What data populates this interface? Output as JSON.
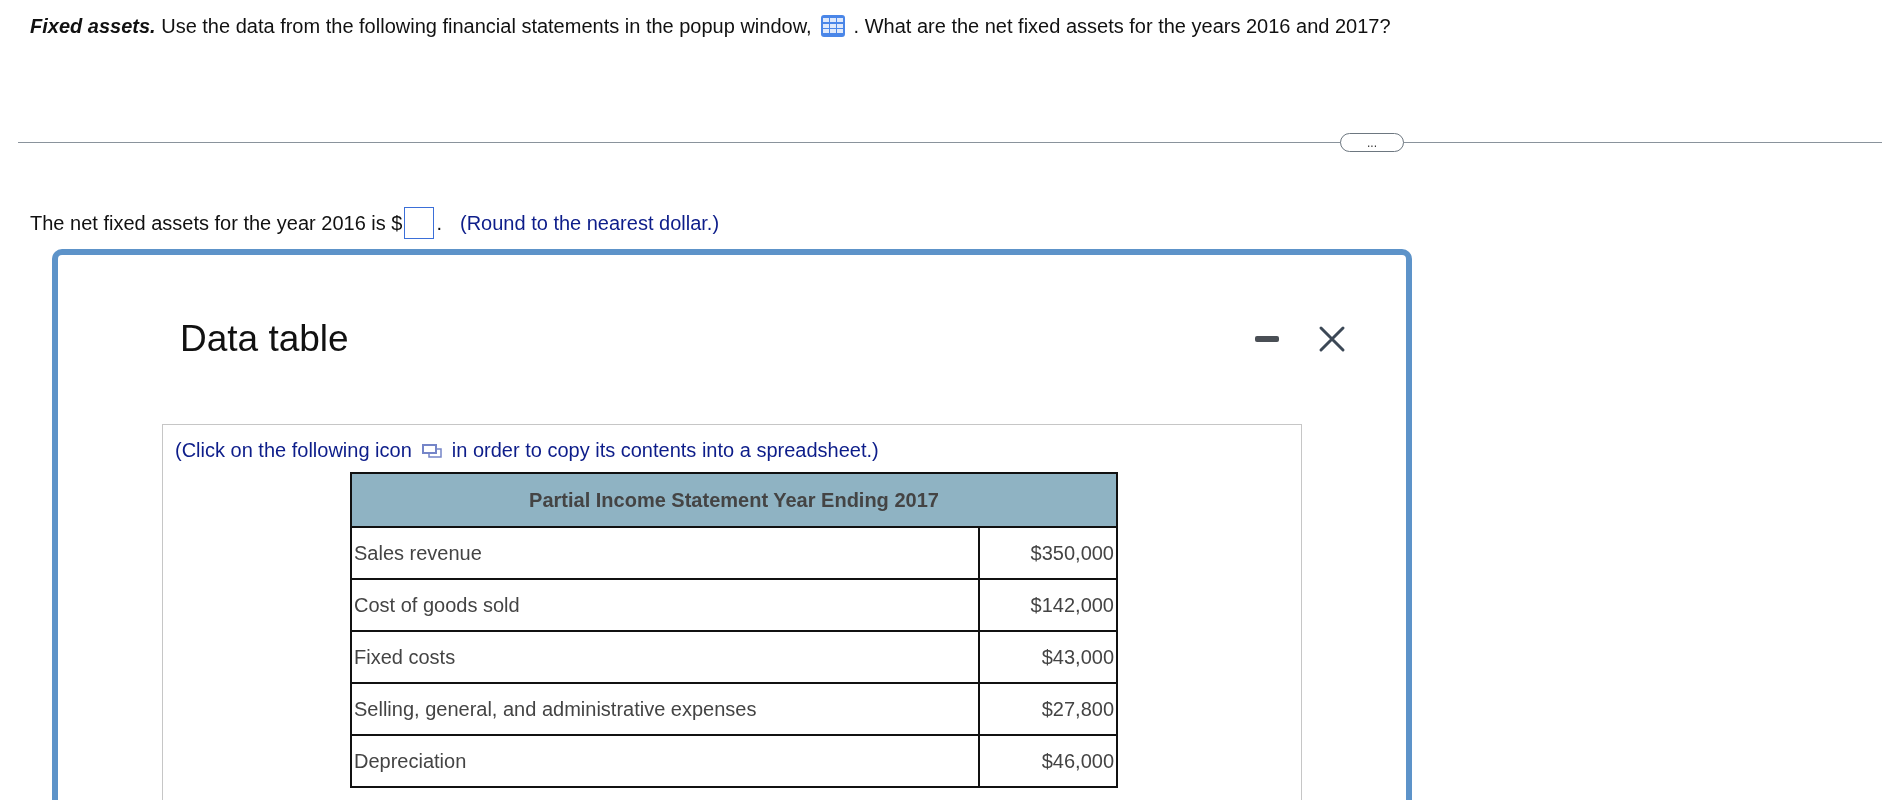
{
  "question": {
    "before_icon": "**Fixed assets.** Use the data from the following financial statements in the popup window,",
    "after_icon": ". What are the net fixed assets for the years 2016 and 2017?"
  },
  "more_button": {
    "label": "..."
  },
  "answer": {
    "prompt": "The net fixed assets for the year 2016 is $",
    "period": ".",
    "hint": "(Round to the nearest dollar.)"
  },
  "popup": {
    "title": "Data table",
    "note_before_icon": "(Click on the following icon",
    "note_after_icon": "in order to copy its contents into a spreadsheet.)",
    "table": {
      "heading": "Partial Income Statement Year Ending 2017",
      "rows": [
        {
          "label": "Sales revenue",
          "value": "$350,000"
        },
        {
          "label": "Cost of goods sold",
          "value": "$142,000"
        },
        {
          "label": "Fixed costs",
          "value": "$43,000"
        },
        {
          "label": "Selling, general, and administrative expenses",
          "value": "$27,800"
        },
        {
          "label": "Depreciation",
          "value": "$46,000"
        }
      ]
    }
  }
}
